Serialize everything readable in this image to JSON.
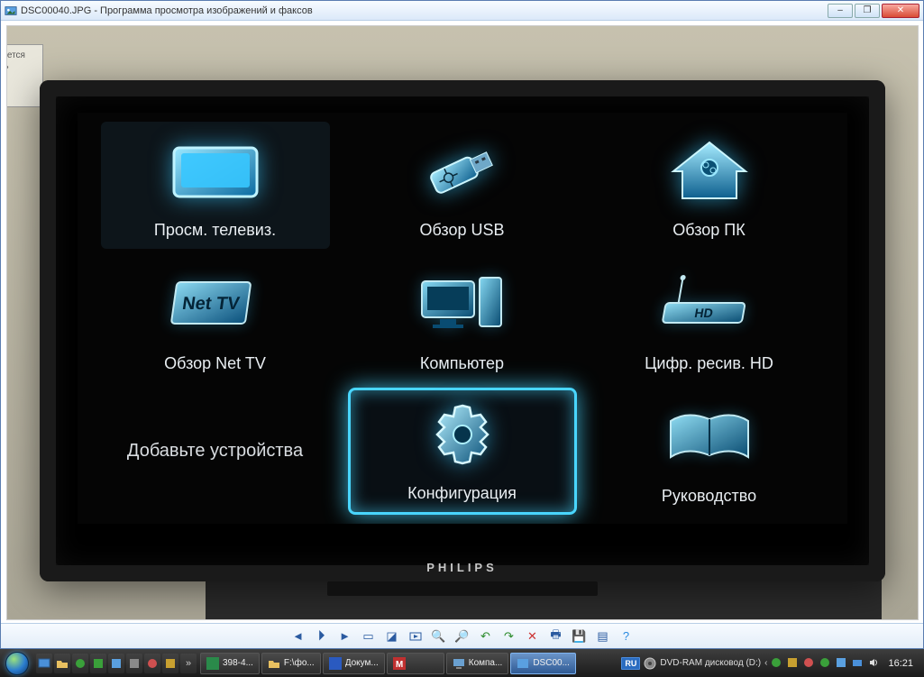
{
  "window": {
    "title": "DSC00040.JPG - Программа просмотра изображений и факсов"
  },
  "tv": {
    "brand": "PHILIPS",
    "menu": {
      "watch_tv": "Просм. телевиз.",
      "browse_usb": "Обзор USB",
      "browse_pc": "Обзор ПК",
      "net_tv": "Обзор Net TV",
      "computer": "Компьютер",
      "hd_receiver": "Цифр. ресив. HD",
      "add_devices": "Добавьте устройства",
      "configuration": "Конфигурация",
      "manual": "Руководство"
    }
  },
  "sign_text": "ес\nется\nать",
  "taskbar": {
    "tasks": [
      {
        "label": "398-4..."
      },
      {
        "label": "F:\\фо..."
      },
      {
        "label": "Докум..."
      },
      {
        "label": ""
      },
      {
        "label": "Компа..."
      },
      {
        "label": "DSC00..."
      }
    ],
    "lang": "RU",
    "drive": "DVD-RAM дисковод (D:)",
    "clock": "16:21"
  }
}
